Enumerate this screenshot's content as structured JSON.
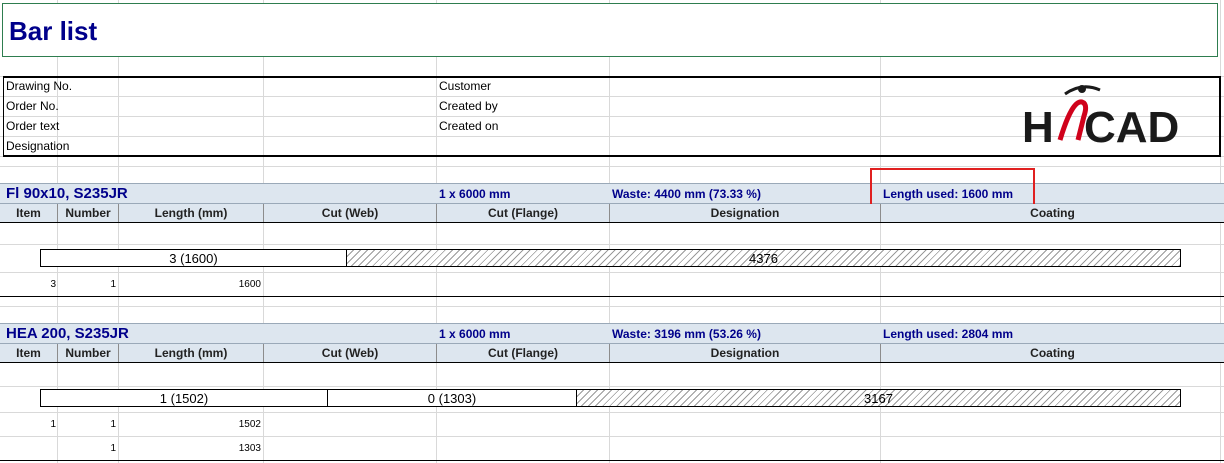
{
  "title": "Bar list",
  "header_fields": {
    "drawing_no": "Drawing No.",
    "order_no": "Order No.",
    "order_text": "Order text",
    "designation": "Designation",
    "customer": "Customer",
    "created_by": "Created by",
    "created_on": "Created on"
  },
  "logo": {
    "text_h": "H",
    "text_i": "i",
    "text_cad": "CAD",
    "colors": {
      "dark": "#1a1a1a",
      "red": "#d0021b"
    }
  },
  "columns": [
    "Item",
    "Number",
    "Length (mm)",
    "Cut (Web)",
    "Cut (Flange)",
    "Designation",
    "Coating"
  ],
  "sections": [
    {
      "profile": "Fl 90x10, S235JR",
      "stock": "1 x 6000 mm",
      "waste": "Waste: 4400 mm (73.33 %)",
      "length_used": "Length used: 1600 mm",
      "highlighted": true,
      "bar_segments": [
        {
          "label": "3 (1600)",
          "type": "part"
        },
        {
          "label": "4376",
          "type": "waste"
        }
      ],
      "rows": [
        {
          "item": "3",
          "number": "1",
          "length": "1600"
        }
      ]
    },
    {
      "profile": "HEA 200, S235JR",
      "stock": "1 x 6000 mm",
      "waste": "Waste: 3196 mm (53.26 %)",
      "length_used": "Length used: 2804 mm",
      "highlighted": false,
      "bar_segments": [
        {
          "label": "1 (1502)",
          "type": "part"
        },
        {
          "label": "0 (1303)",
          "type": "part"
        },
        {
          "label": "3167",
          "type": "waste"
        }
      ],
      "rows": [
        {
          "item": "1",
          "number": "1",
          "length": "1502"
        },
        {
          "item": "",
          "number": "1",
          "length": "1303"
        }
      ]
    }
  ],
  "colors": {
    "accent_blue": "#00008b",
    "section_bg": "#dde6ef",
    "highlight_red": "#e02020",
    "title_border": "#2e7d4f"
  }
}
